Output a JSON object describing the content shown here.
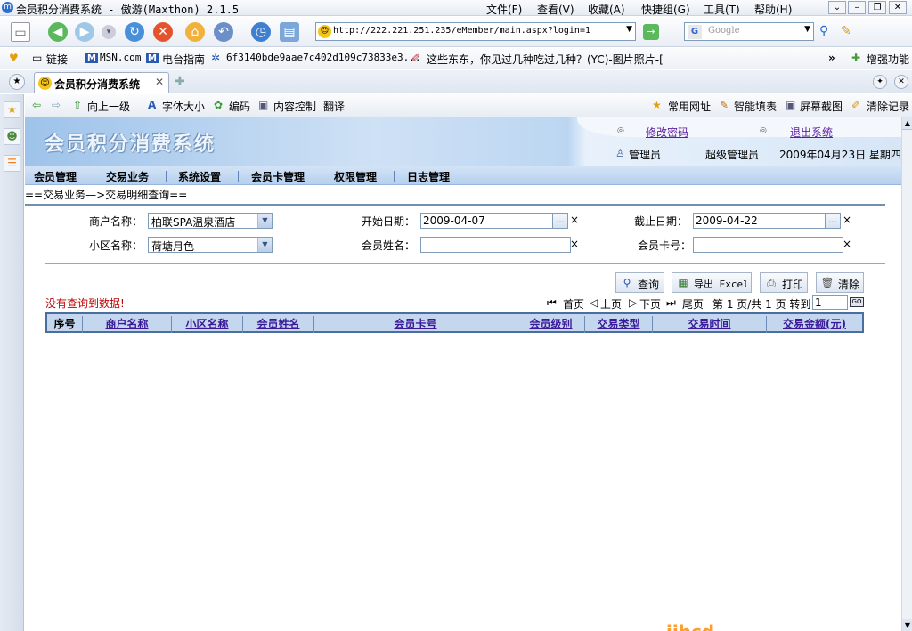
{
  "window": {
    "title": "会员积分消费系统 - 傲游(Maxthon) 2.1.5",
    "menu": [
      "文件(F)",
      "查看(V)",
      "收藏(A)",
      "快捷组(G)",
      "工具(T)",
      "帮助(H)"
    ]
  },
  "toolbar": {
    "address": "http://222.221.251.235/eMember/main.aspx?login=1",
    "search_placeholder": "Google"
  },
  "links_bar": {
    "items": [
      "链接",
      "MSN.com",
      "电台指南",
      "6f3140bde9aae7c402d109c73833e3...",
      "这些东东，你见过几种吃过几种？(YC)-图片照片-[",
      "增强功能"
    ]
  },
  "tab": {
    "title": "会员积分消费系统"
  },
  "page_toolbar": {
    "items": [
      "向上一级",
      "字体大小",
      "编码",
      "内容控制",
      "翻译"
    ],
    "right_items": [
      "常用网址",
      "智能填表",
      "屏幕截图",
      "清除记录"
    ]
  },
  "banner": {
    "logo": "会员积分消费系统",
    "change_password": "修改密码",
    "logout": "退出系统",
    "user_role": "管理员",
    "user_name": "超级管理员",
    "date": "2009年04月23日 星期四"
  },
  "nav": {
    "items": [
      "会员管理",
      "交易业务",
      "系统设置",
      "会员卡管理",
      "权限管理",
      "日志管理"
    ]
  },
  "breadcrumb": "==交易业务—>交易明细查询==",
  "form": {
    "merchant_label": "商户名称：",
    "merchant_value": "柏联SPA温泉酒店",
    "start_label": "开始日期：",
    "start_value": "2009-04-07",
    "end_label": "截止日期：",
    "end_value": "2009-04-22",
    "area_label": "小区名称：",
    "area_value": "荷塘月色",
    "name_label": "会员姓名：",
    "name_value": "",
    "card_label": "会员卡号：",
    "card_value": "",
    "dots": "...",
    "clear_mark": "×"
  },
  "buttons": {
    "query": "查询",
    "export": "导出 Excel",
    "print": "打印",
    "clear": "清除"
  },
  "result": {
    "no_data": "没有查询到数据!"
  },
  "pager": {
    "first": "首页",
    "prev": "上页",
    "next": "下页",
    "last": "尾页",
    "info": "第 1 页/共 1 页 转到",
    "goto_value": "1",
    "go": "GO"
  },
  "grid": {
    "headers": [
      "序号",
      "商户名称",
      "小区名称",
      "会员姓名",
      "会员卡号",
      "会员级别",
      "交易类型",
      "交易时间",
      "交易金额(元)"
    ]
  },
  "watermark": "jjhcd"
}
